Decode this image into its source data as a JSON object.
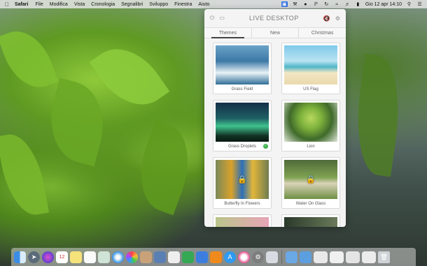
{
  "menubar": {
    "apple_icon": "apple-icon",
    "app_name": "Safari",
    "menus": [
      "File",
      "Modifica",
      "Vista",
      "Cronologia",
      "Segnalibri",
      "Sviluppo",
      "Finestra",
      "Aiuto"
    ],
    "datetime": "Gio 12 apr  14:10"
  },
  "panel": {
    "title": "LIVE DESKTOP",
    "tabs": [
      "Themes",
      "New",
      "Christmas"
    ],
    "active_tab": "Themes",
    "items": [
      {
        "label": "Grass Field",
        "locked": false,
        "selected": false
      },
      {
        "label": "US Flag",
        "locked": false,
        "selected": false
      },
      {
        "label": "Grass Droplets",
        "locked": false,
        "selected": true
      },
      {
        "label": "Lion",
        "locked": false,
        "selected": false
      },
      {
        "label": "Butterfly In Flowers",
        "locked": true,
        "selected": false
      },
      {
        "label": "Water On Glass",
        "locked": true,
        "selected": false
      }
    ]
  },
  "colors": {
    "menubar_highlight": "#2f6fe0",
    "selected_check": "#3fb34f"
  }
}
